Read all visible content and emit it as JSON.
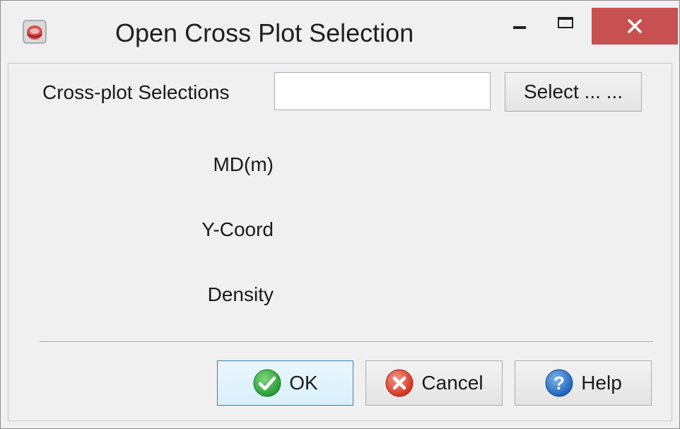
{
  "window": {
    "title": "Open Cross Plot Selection",
    "controls": {
      "minimize_icon": "minimize-icon",
      "maximize_icon": "maximize-icon",
      "close_icon": "close-icon",
      "close_label": "✕"
    },
    "close_color": "#c75050"
  },
  "form": {
    "selections_label": "Cross-plot Selections",
    "selections_value": "",
    "select_button_label": "Select ... ...",
    "fields": [
      {
        "label": "MD(m)"
      },
      {
        "label": "Y-Coord"
      },
      {
        "label": "Density"
      }
    ]
  },
  "buttons": {
    "ok_label": "OK",
    "ok_icon": "check-icon",
    "ok_color": "#2e9e3c",
    "cancel_label": "Cancel",
    "cancel_icon": "cancel-icon",
    "cancel_color": "#d9432f",
    "help_label": "Help",
    "help_icon": "question-icon",
    "help_color": "#1e6fc7"
  }
}
